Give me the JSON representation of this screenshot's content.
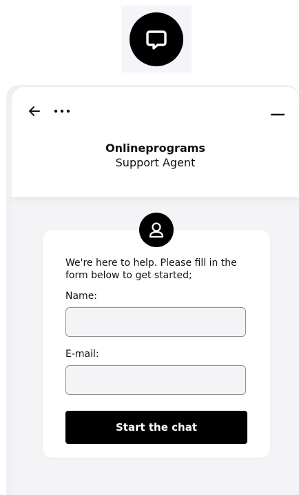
{
  "launcher": {
    "icon": "chat-bubble-icon"
  },
  "header": {
    "title": "Onlineprograms",
    "subtitle": "Support Agent",
    "back_icon": "arrow-left-icon",
    "more_icon": "more-dots-icon",
    "minimize_icon": "minimize-icon"
  },
  "form": {
    "avatar_icon": "user-icon",
    "intro_text": "We're here to help. Please fill in the form below to get started;",
    "name_label": "Name:",
    "name_value": "",
    "email_label": "E-mail:",
    "email_value": "",
    "submit_label": "Start the chat"
  },
  "colors": {
    "accent": "#000000",
    "panel_bg": "#f4f4f6",
    "card_bg": "#ffffff"
  }
}
